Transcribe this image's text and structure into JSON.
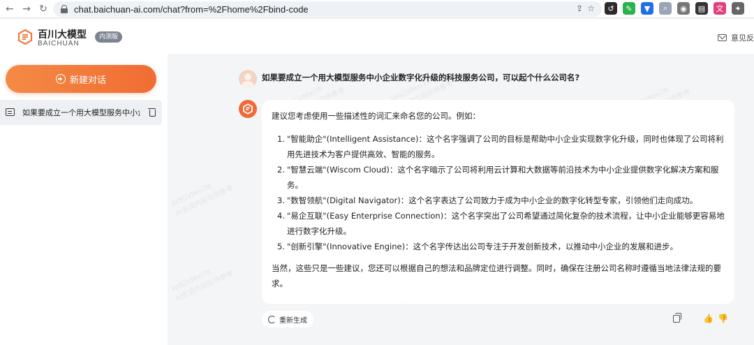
{
  "browser": {
    "url": "chat.baichuan-ai.com/chat?from=%2Fhome%2Fbind-code",
    "back_glyph": "←",
    "forward_glyph": "→",
    "reload_glyph": "↻"
  },
  "header": {
    "brand_cn": "百川大模型",
    "brand_en": "BAICHUAN",
    "badge": "内测版",
    "feedback_label": "意见反"
  },
  "sidebar": {
    "new_chat_label": "新建对话",
    "conversations": [
      {
        "title": "如果要成立一个用大模型服务中小企业数字化升级的科技服务公司，可以起个什么公司名？"
      }
    ]
  },
  "chat": {
    "question": "如果要成立一个用大模型服务中小企业数字化升级的科技服务公司，可以起个什么公司名?",
    "answer_intro": "建议您考虑使用一些描述性的词汇来命名您的公司。例如：",
    "suggestions": [
      {
        "num": "1.",
        "text": "\"智能助企\"(Intelligent Assistance)：这个名字强调了公司的目标是帮助中小企业实现数字化升级，同时也体现了公司将利用先进技术为客户提供高效、智能的服务。"
      },
      {
        "num": "2.",
        "text": "\"智慧云端\"(Wiscom Cloud)：这个名字暗示了公司将利用云计算和大数据等前沿技术为中小企业提供数字化解决方案和服务。"
      },
      {
        "num": "3.",
        "text": "\"数智领航\"(Digital Navigator)：这个名字表达了公司致力于成为中小企业的数字化转型专家，引领他们走向成功。"
      },
      {
        "num": "4.",
        "text": "\"易企互联\"(Easy Enterprise Connection)：这个名字突出了公司希望通过简化复杂的技术流程，让中小企业能够更容易地进行数字化升级。"
      },
      {
        "num": "5.",
        "text": "\"创新引擎\"(Innovative Engine)：这个名字传达出公司专注于开发创新技术，以推动中小企业的发展和进步。"
      }
    ],
    "answer_closing": "当然，这些只是一些建议，您还可以根据自己的想法和品牌定位进行调整。同时，确保在注册公司名称时遵循当地法律法规的要求。",
    "regenerate_label": "重新生成"
  },
  "watermark": {
    "line1": "WdGVMm7R",
    "line2": "AI生成内容仅供参考"
  },
  "colors": {
    "accent": "#f06d33",
    "sidebar_bg": "#ffffff",
    "chat_bg": "#f4f5f7"
  }
}
